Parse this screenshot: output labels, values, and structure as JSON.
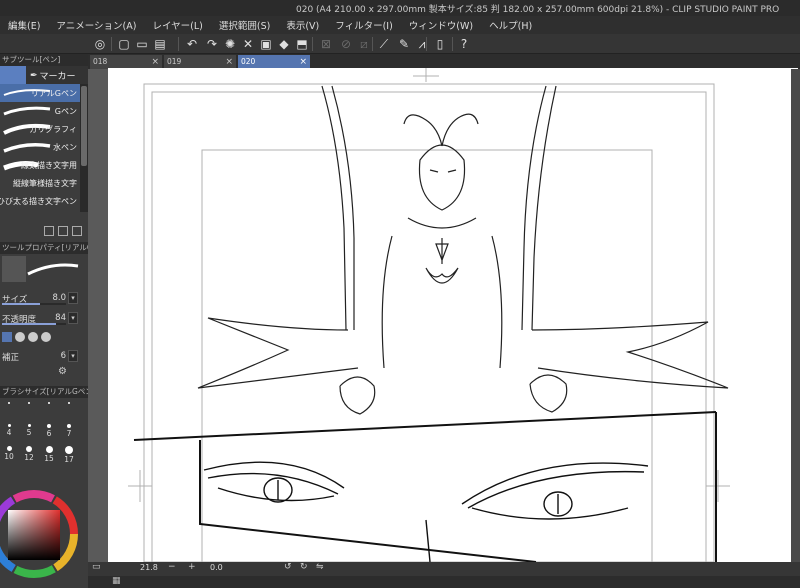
{
  "window": {
    "title": "020 (A4 210.00 x 297.00mm 製本サイズ:85 判 182.00 x 257.00mm 600dpi 21.8%)  - CLIP STUDIO PAINT PRO"
  },
  "menu": {
    "items": [
      "編集(E)",
      "アニメーション(A)",
      "レイヤー(L)",
      "選択範囲(S)",
      "表示(V)",
      "フィルター(I)",
      "ウィンドウ(W)",
      "ヘルプ(H)"
    ]
  },
  "subtool_panel": {
    "header": "サブツール[ペン]",
    "group_tab": "マーカー",
    "brushes": [
      {
        "name": "リアルGペン",
        "selected": true
      },
      {
        "name": "Gペン",
        "selected": false
      },
      {
        "name": "カリグラフィ",
        "selected": false
      },
      {
        "name": "水ペン",
        "selected": false
      },
      {
        "name": "線太描き文字用",
        "selected": false
      },
      {
        "name": "縦線筆様描き文字",
        "selected": false
      },
      {
        "name": "ひび太る描き文字ペン",
        "selected": false
      }
    ]
  },
  "tool_property": {
    "header": "ツールプロパティ[リアルGペン]",
    "size_label": "サイズ",
    "size_value": "8.0",
    "size_fraction": 0.6,
    "opacity_label": "不透明度",
    "opacity_value": "84",
    "opacity_fraction": 0.84,
    "correction_label": "補正",
    "correction_value": "6"
  },
  "brush_size_panel": {
    "header": "ブラシサイズ[リアルGペン]",
    "sizes": [
      "",
      "",
      "",
      "",
      "4",
      "5",
      "6",
      "7",
      "10",
      "12",
      "15",
      "17"
    ]
  },
  "document_tabs": [
    {
      "label": "018",
      "active": false
    },
    {
      "label": "019",
      "active": false
    },
    {
      "label": "020",
      "active": true
    }
  ],
  "status": {
    "zoom": "21.8",
    "angle": "0.0"
  },
  "colors": {
    "accent": "#5575b0",
    "selection": "#4a6ea8",
    "panel_bg": "#3c3c3c"
  }
}
